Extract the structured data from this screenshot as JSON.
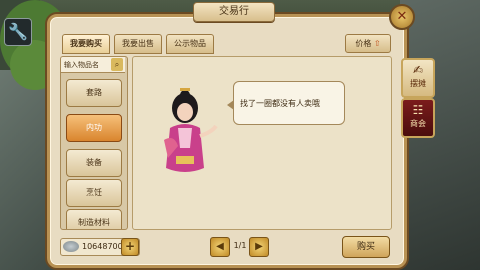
{
  "window": {
    "title": "交易行"
  },
  "tabs": [
    {
      "label": "我要购买",
      "active": true
    },
    {
      "label": "我要出售",
      "active": false
    },
    {
      "label": "公示物品",
      "active": false
    }
  ],
  "sort": {
    "label": "价格",
    "arrow": "⇧"
  },
  "search": {
    "placeholder": "输入物品名"
  },
  "categories": [
    {
      "label": "套路",
      "selected": false
    },
    {
      "label": "内功",
      "selected": true
    },
    {
      "label": "装备",
      "selected": false
    },
    {
      "label": "烹饪",
      "selected": false
    },
    {
      "label": "制造材料",
      "selected": false
    }
  ],
  "npc": {
    "message": "找了一圈都没有人卖哦"
  },
  "wallet": {
    "amount": "10648700"
  },
  "pager": {
    "page": "1/1"
  },
  "actions": {
    "buy_label": "购买"
  },
  "side_tabs": [
    {
      "label": "摆摊"
    },
    {
      "label": "商会"
    }
  ],
  "colors": {
    "accent": "#d9852e",
    "panel": "#e8dcc2",
    "frame": "#b89254"
  }
}
